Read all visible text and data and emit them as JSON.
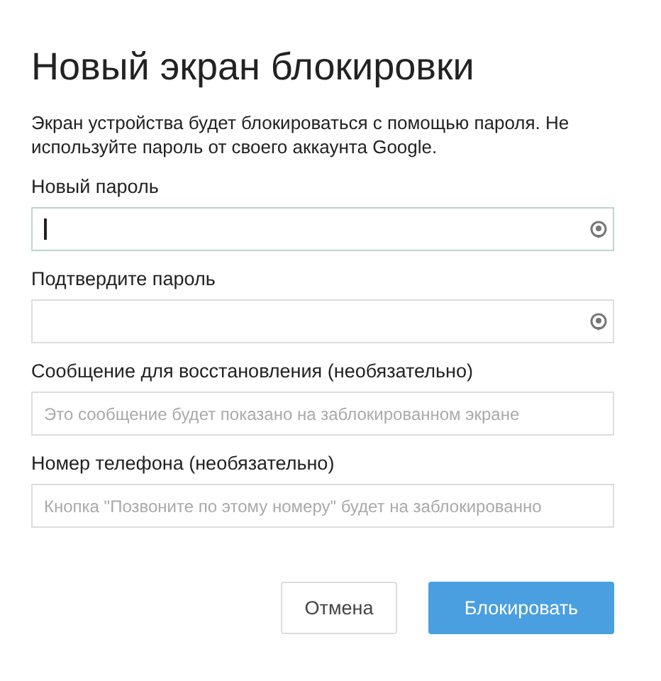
{
  "title": "Новый экран блокировки",
  "description": "Экран устройства будет блокироваться с помощью пароля. Не используйте пароль от своего аккаунта Google.",
  "fields": [
    {
      "kind": "password",
      "label": "Новый пароль",
      "focused": true
    },
    {
      "kind": "password",
      "label": "Подтвердите пароль",
      "focused": false
    },
    {
      "kind": "text",
      "label": "Сообщение для восстановления (необязательно)",
      "placeholder": "Это сообщение будет показано на заблокированном экране",
      "focused": false
    },
    {
      "kind": "text",
      "label": "Номер телефона (необязательно)",
      "placeholder": "Кнопка \"Позвоните по этому номеру\" будет на заблокированно",
      "focused": false
    }
  ],
  "buttons": [
    {
      "kind": "secondary",
      "label": "Отмена"
    },
    {
      "kind": "primary",
      "label": "Блокировать"
    }
  ]
}
